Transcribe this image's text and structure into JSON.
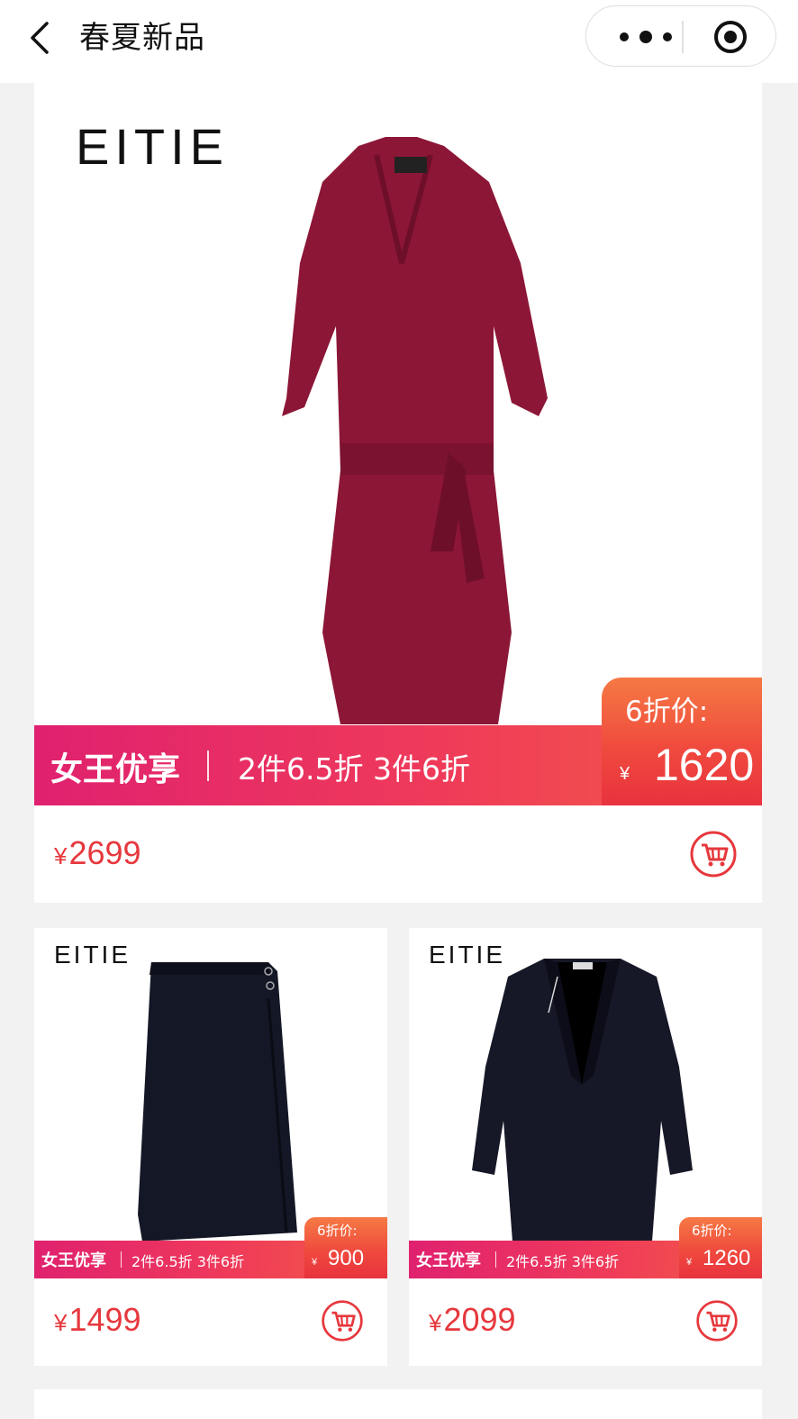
{
  "header": {
    "title": "春夏新品"
  },
  "colors": {
    "accent_red": "#e6383d",
    "banner_start": "#e0216f",
    "banner_end": "#f35b45",
    "price_box": "#f04a3e"
  },
  "products": [
    {
      "brand": "EITIE",
      "image": "burgundy-lace-dress",
      "promo_tag": "女王优享",
      "promo_deal": "2件6.5折 3件6折",
      "discount_label": "6折价:",
      "currency": "¥",
      "discount_price": "1620",
      "price": "2699"
    },
    {
      "brand": "EITIE",
      "image": "black-pencil-skirt",
      "promo_tag": "女王优享",
      "promo_deal": "2件6.5折 3件6折",
      "discount_label": "6折价:",
      "currency": "¥",
      "discount_price": "900",
      "price": "1499"
    },
    {
      "brand": "EITIE",
      "image": "black-blazer",
      "promo_tag": "女王优享",
      "promo_deal": "2件6.5折 3件6折",
      "discount_label": "6折价:",
      "currency": "¥",
      "discount_price": "1260",
      "price": "2099"
    }
  ]
}
